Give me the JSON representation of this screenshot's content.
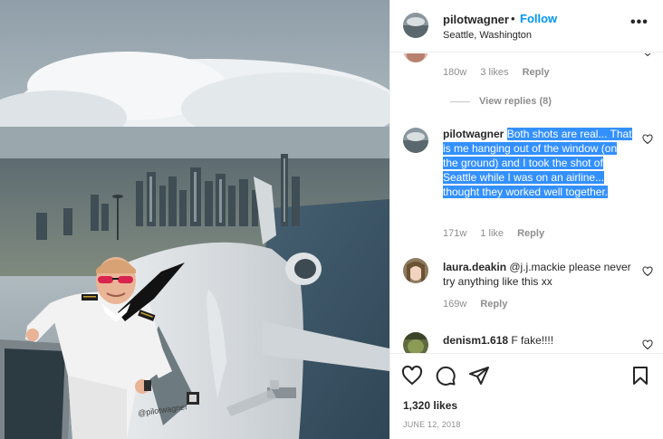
{
  "post": {
    "photo_watermark": "@pilotwagner",
    "header": {
      "username": "pilotwagner",
      "separator": "•",
      "follow_label": "Follow",
      "location": "Seattle, Washington",
      "more_label": "•••"
    },
    "comments": {
      "top_partial": {
        "age": "180w",
        "likes": "3 likes",
        "reply_label": "Reply",
        "view_replies": "View replies (8)"
      },
      "items": [
        {
          "username": "pilotwagner",
          "text": "Both shots are real... That is me hanging out of the window (on the ground) and I took the shot of Seattle while I was on an airline... thought they worked well together.",
          "age": "171w",
          "likes": "1 like",
          "reply_label": "Reply"
        },
        {
          "username": "laura.deakin",
          "text": "@j.j.mackie please never try anything like this xx",
          "age": "169w",
          "reply_label": "Reply"
        },
        {
          "username": "denism1.618",
          "text": "F fake!!!!"
        }
      ]
    },
    "actions": {
      "icons": [
        "heart-icon",
        "comment-icon",
        "share-icon",
        "save-icon"
      ],
      "likes_count": "1,320 likes",
      "date": "JUNE 12, 2018"
    }
  },
  "colors": {
    "accent": "#0095f6",
    "selection": "#3390ff",
    "muted": "#8e8e8e",
    "text": "#262626"
  }
}
